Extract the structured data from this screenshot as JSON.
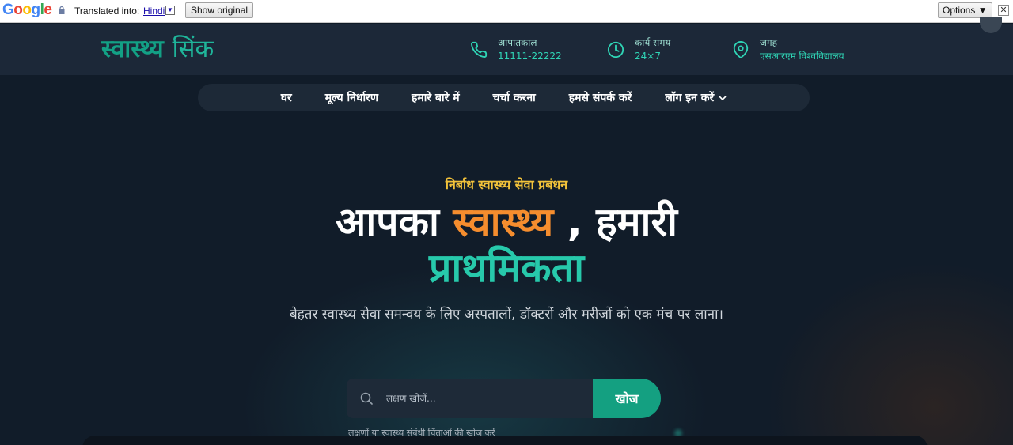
{
  "translate_bar": {
    "translated_into": "Translated into:",
    "language": "Hindi",
    "show_original": "Show original",
    "options": "Options ▼",
    "close": "✕"
  },
  "header": {
    "logo_part1": "स्वास्थ्य",
    "logo_part2": "सिंक",
    "emergency": {
      "label": "आपातकाल",
      "value": "11111-22222",
      "icon": "phone-icon"
    },
    "hours": {
      "label": "कार्य समय",
      "value": "24×7",
      "icon": "clock-icon"
    },
    "location": {
      "label": "जगह",
      "value": "एसआरएम विश्वविद्यालय",
      "icon": "location-pin-icon"
    }
  },
  "nav": {
    "items": [
      {
        "label": "घर"
      },
      {
        "label": "मूल्य निर्धारण"
      },
      {
        "label": "हमारे बारे में"
      },
      {
        "label": "चर्चा करना"
      },
      {
        "label": "हमसे संपर्क करें"
      },
      {
        "label": "लॉग इन करें"
      }
    ]
  },
  "hero": {
    "tagline": "निर्बाध स्वास्थ्य सेवा प्रबंधन",
    "headline_part1": "आपका ",
    "headline_highlight": "स्वास्थ्य",
    "headline_part2": " , हमारी",
    "headline_line2": "प्राथमिकता",
    "subtitle": "बेहतर स्वास्थ्य सेवा समन्वय के लिए अस्पतालों, डॉक्टरों और मरीजों को एक मंच पर लाना।",
    "search_placeholder": "लक्षण खोजें...",
    "search_button": "खोज",
    "search_hint": "लक्षणों या स्वास्थ्य संबंधी चिंताओं की खोज करें"
  },
  "colors": {
    "brand_teal": "#14a081",
    "accent_orange": "#f58d2e",
    "tagline_yellow": "#f2c23a",
    "background": "#111c29"
  }
}
